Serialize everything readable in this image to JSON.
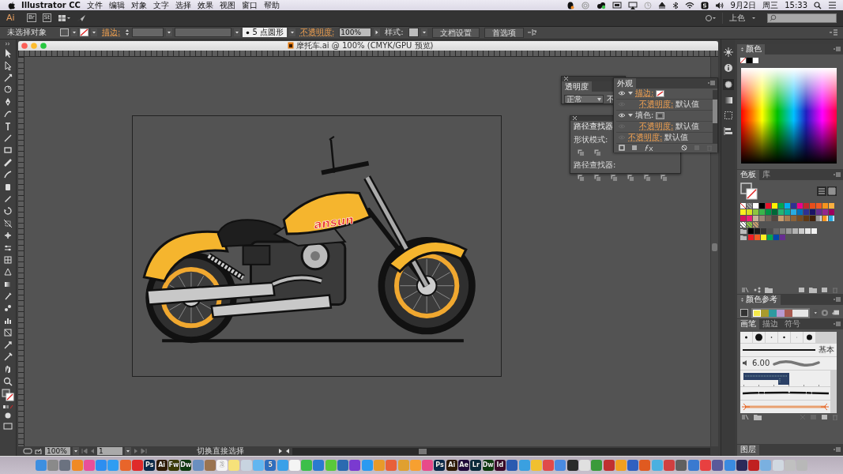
{
  "menubar": {
    "app": "Illustrator CC",
    "menus": [
      "文件",
      "编辑",
      "对象",
      "文字",
      "选择",
      "效果",
      "视图",
      "窗口",
      "帮助"
    ],
    "date": "9月2日",
    "weekday": "周三",
    "time": "15:33"
  },
  "appbar": {
    "logo": "Ai",
    "buttons": [
      "Br",
      "St"
    ],
    "workspace": "上色"
  },
  "control_bar": {
    "selection": "未选择对象",
    "stroke_label": "描边:",
    "brush": "5 点圆形",
    "opacity_label": "不透明度:",
    "opacity": "100%",
    "style_label": "样式:",
    "buttons": [
      "文档设置",
      "首选项"
    ]
  },
  "document": {
    "title": "摩托车.ai @ 100% (CMYK/GPU 预览)",
    "artwork_logo": "ansun"
  },
  "transparency_panel": {
    "title": "透明度",
    "blend_mode": "正常",
    "opacity_label": "不"
  },
  "pathfinder_panel": {
    "title": "路径查找器",
    "shape_modes_label": "形状模式:",
    "pathfinders_label": "路径查找器:"
  },
  "appearance_panel": {
    "title": "外观",
    "items": [
      {
        "kind": "stroke",
        "label": "描边:",
        "expanded": true,
        "children": [
          {
            "kind": "opacity",
            "label": "不透明度:",
            "value": "默认值"
          }
        ]
      },
      {
        "kind": "fill",
        "label": "填色:",
        "expanded": true,
        "children": [
          {
            "kind": "opacity",
            "label": "不透明度:",
            "value": "默认值"
          }
        ]
      },
      {
        "kind": "opacity",
        "label": "不透明度:",
        "value": "默认值"
      }
    ]
  },
  "color_panel": {
    "title": "颜色"
  },
  "swatches_panel": {
    "tabs": [
      {
        "label": "色板",
        "selected": true
      },
      {
        "label": "库",
        "selected": false
      }
    ],
    "rows": [
      {
        "items": [
          {
            "kind": "none",
            "color": "#ffffff"
          },
          {
            "kind": "pattern",
            "color": "#9a9a9a"
          },
          {
            "kind": "solid",
            "color": "#ffffff"
          },
          {
            "kind": "solid",
            "color": "#000000"
          },
          {
            "kind": "solid",
            "color": "#e8132a"
          },
          {
            "kind": "solid",
            "color": "#fff100"
          },
          {
            "kind": "solid",
            "color": "#00a651"
          },
          {
            "kind": "solid",
            "color": "#00aeef"
          },
          {
            "kind": "solid",
            "color": "#2e3192"
          },
          {
            "kind": "solid",
            "color": "#ec008c"
          },
          {
            "kind": "solid",
            "color": "#c1272d"
          },
          {
            "kind": "solid",
            "color": "#e94e1b"
          },
          {
            "kind": "solid",
            "color": "#f15a24"
          },
          {
            "kind": "solid",
            "color": "#f7941d"
          },
          {
            "kind": "solid",
            "color": "#fbb040"
          }
        ]
      },
      {
        "items": [
          {
            "kind": "solid",
            "color": "#fcee21"
          },
          {
            "kind": "solid",
            "color": "#d9e021"
          },
          {
            "kind": "solid",
            "color": "#8cc63f"
          },
          {
            "kind": "solid",
            "color": "#39b54a"
          },
          {
            "kind": "solid",
            "color": "#009245"
          },
          {
            "kind": "solid",
            "color": "#006837"
          },
          {
            "kind": "solid",
            "color": "#22b573"
          },
          {
            "kind": "solid",
            "color": "#00a99d"
          },
          {
            "kind": "solid",
            "color": "#29abe2"
          },
          {
            "kind": "solid",
            "color": "#0071bc"
          },
          {
            "kind": "solid",
            "color": "#2e3192"
          },
          {
            "kind": "solid",
            "color": "#1b1464"
          },
          {
            "kind": "solid",
            "color": "#662d91"
          },
          {
            "kind": "solid",
            "color": "#93278f"
          },
          {
            "kind": "solid",
            "color": "#9e005d"
          }
        ]
      },
      {
        "items": [
          {
            "kind": "solid",
            "color": "#d4145a"
          },
          {
            "kind": "solid",
            "color": "#ed1e79"
          },
          {
            "kind": "solid",
            "color": "#c7b299"
          },
          {
            "kind": "solid",
            "color": "#998675"
          },
          {
            "kind": "solid",
            "color": "#736357"
          },
          {
            "kind": "solid",
            "color": "#534741"
          },
          {
            "kind": "solid",
            "color": "#c69c6d"
          },
          {
            "kind": "solid",
            "color": "#a67c52"
          },
          {
            "kind": "solid",
            "color": "#8c6239"
          },
          {
            "kind": "solid",
            "color": "#754c24"
          },
          {
            "kind": "solid",
            "color": "#603813"
          },
          {
            "kind": "solid",
            "color": "#42210b"
          },
          {
            "kind": "gradient",
            "color": "#9a9a9a"
          },
          {
            "kind": "gradient",
            "color": "#f7941d"
          },
          {
            "kind": "gradient",
            "color": "#29abe2"
          }
        ]
      },
      {
        "items": [
          {
            "kind": "pattern",
            "color": "#ffffff"
          },
          {
            "kind": "pattern",
            "color": "#8cc63f"
          },
          {
            "kind": "pattern",
            "color": "#c69c6d"
          }
        ]
      },
      {
        "kind": "group",
        "items": [
          {
            "kind": "solid",
            "color": "#000000"
          },
          {
            "kind": "solid",
            "color": "#1a1a1a"
          },
          {
            "kind": "solid",
            "color": "#333333"
          },
          {
            "kind": "solid",
            "color": "#4d4d4d"
          },
          {
            "kind": "solid",
            "color": "#666666"
          },
          {
            "kind": "solid",
            "color": "#808080"
          },
          {
            "kind": "solid",
            "color": "#999999"
          },
          {
            "kind": "solid",
            "color": "#b3b3b3"
          },
          {
            "kind": "solid",
            "color": "#cccccc"
          },
          {
            "kind": "solid",
            "color": "#e6e6e6"
          },
          {
            "kind": "solid",
            "color": "#f2f2f2"
          }
        ]
      },
      {
        "kind": "group",
        "items": [
          {
            "kind": "solid",
            "color": "#ed1c24"
          },
          {
            "kind": "solid",
            "color": "#f15a24"
          },
          {
            "kind": "solid",
            "color": "#fcee21"
          },
          {
            "kind": "solid",
            "color": "#00a651"
          },
          {
            "kind": "solid",
            "color": "#0047ab"
          },
          {
            "kind": "solid",
            "color": "#662d91"
          }
        ]
      }
    ]
  },
  "color_guide_panel": {
    "title": "颜色参考",
    "colors": [
      {
        "color": "#f5e94a"
      },
      {
        "color": "#a89a2e"
      },
      {
        "color": "#2e9aa0"
      },
      {
        "color": "#b89ad0"
      },
      {
        "color": "#a85a50"
      },
      {
        "color": "#e6e6e6"
      }
    ]
  },
  "brushes_panel": {
    "tabs": [
      {
        "label": "画笔",
        "selected": true
      },
      {
        "label": "描边",
        "selected": false
      },
      {
        "label": "符号",
        "selected": false
      }
    ],
    "basic_label": "基本",
    "size": "6.00"
  },
  "layers_panel": {
    "title": "图层"
  },
  "status_bar": {
    "zoom": "100%",
    "artboard": "1",
    "tool": "切换直接选择"
  },
  "dock": [
    {
      "color": "#3d8fe0"
    },
    {
      "color": "#8a8a8a"
    },
    {
      "color": "#6b7280"
    },
    {
      "color": "#f08a24"
    },
    {
      "color": "#e84f9b"
    },
    {
      "color": "#2d8ef0"
    },
    {
      "color": "#2f9df2"
    },
    {
      "color": "#e8652a"
    },
    {
      "color": "#e02a2a"
    },
    {
      "color": "#0b2a4a",
      "label": "Ps"
    },
    {
      "color": "#2e1a05",
      "label": "Ai"
    },
    {
      "color": "#3b3a05",
      "label": "Fw"
    },
    {
      "color": "#0e3a0e",
      "label": "Dw"
    },
    {
      "color": "#6a8fc0"
    },
    {
      "color": "#9a7450"
    },
    {
      "color": "#f4f4f4",
      "label": "2"
    },
    {
      "color": "#f6e27a"
    },
    {
      "color": "#c8d4e0"
    },
    {
      "color": "#62b6f0"
    },
    {
      "color": "#2f6fc0",
      "label": "5"
    },
    {
      "color": "#3aa0e8"
    },
    {
      "color": "#f4f4f4"
    },
    {
      "color": "#3cbf4a"
    },
    {
      "color": "#2a7ad0"
    },
    {
      "color": "#5ac83a"
    },
    {
      "color": "#2a6ab0"
    },
    {
      "color": "#7a3ad0"
    },
    {
      "color": "#2a9af0"
    },
    {
      "color": "#e89a2a"
    },
    {
      "color": "#e8603a"
    },
    {
      "color": "#e0a030"
    },
    {
      "color": "#f7a030"
    },
    {
      "color": "#e84a8a"
    },
    {
      "color": "#0b2a4a",
      "label": "Ps"
    },
    {
      "color": "#2e1a05",
      "label": "Ai"
    },
    {
      "color": "#1f0a3a",
      "label": "Ae"
    },
    {
      "color": "#0a2a3a",
      "label": "Lr"
    },
    {
      "color": "#0e3a0e",
      "label": "Dw"
    },
    {
      "color": "#3a0a2a",
      "label": "Id"
    },
    {
      "color": "#2a5ab0"
    },
    {
      "color": "#3aa0e0"
    },
    {
      "color": "#f0c030"
    },
    {
      "color": "#e04a4a"
    },
    {
      "color": "#4a8ae0"
    },
    {
      "color": "#2a2a2a"
    },
    {
      "color": "#e0e0e0"
    },
    {
      "color": "#3a9a3a"
    },
    {
      "color": "#c03030"
    },
    {
      "color": "#f0a020"
    },
    {
      "color": "#3060c0"
    },
    {
      "color": "#e05a20"
    },
    {
      "color": "#4ab0e0"
    },
    {
      "color": "#d04040"
    },
    {
      "color": "#606060"
    },
    {
      "color": "#3a7ad0"
    },
    {
      "color": "#e84040"
    },
    {
      "color": "#5a5a9a"
    },
    {
      "color": "#3a8ae0"
    },
    {
      "color": "#2a2a5a"
    },
    {
      "color": "#c02020"
    },
    {
      "color": "#7ab0e0"
    },
    {
      "color": "#d0d8e0"
    },
    {
      "color": "#c0c0c0"
    },
    {
      "color": "#b8b8b8"
    }
  ]
}
